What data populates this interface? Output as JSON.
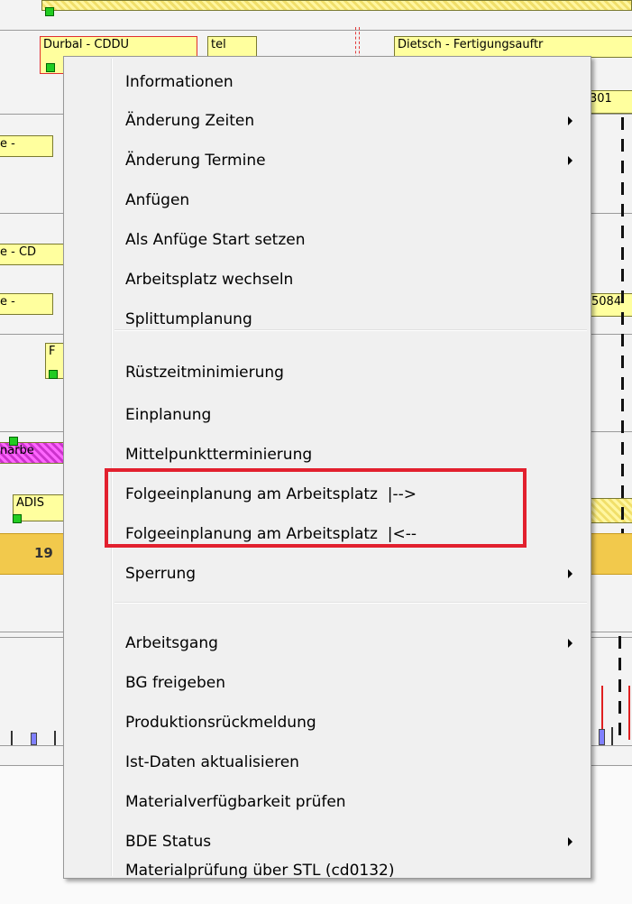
{
  "gantt": {
    "bar_top_label": "Durbal - CDDU",
    "bar_top_small": "tel",
    "bar_top_right": "Dietsch - Fertigungsauftr",
    "bar_right_1": "301",
    "bar_left_1": "e -",
    "bar_left_2": "e - CD",
    "bar_left_3": "e -",
    "bar_right_2": "5084",
    "bar_left_4": "F",
    "bar_left_5": "narbe",
    "bar_left_6": "ADIS",
    "date_label": "19"
  },
  "menu": {
    "items": [
      {
        "label": "Informationen",
        "submenu": false
      },
      {
        "label": "Änderung Zeiten",
        "submenu": true
      },
      {
        "label": "Änderung Termine",
        "submenu": true
      },
      {
        "label": "Anfügen",
        "submenu": false
      },
      {
        "label": "Als Anfüge Start setzen",
        "submenu": false
      },
      {
        "label": "Arbeitsplatz wechseln",
        "submenu": false
      },
      {
        "label": "Splittumplanung",
        "submenu": false
      },
      {
        "label": "Rüstzeitminimierung",
        "submenu": false
      },
      {
        "label": "Einplanung",
        "submenu": false
      },
      {
        "label": "Mittelpunktterminierung",
        "submenu": false
      },
      {
        "label": "Folgeeinplanung am Arbeitsplatz  |-->",
        "submenu": false
      },
      {
        "label": "Folgeeinplanung am Arbeitsplatz  |<--",
        "submenu": false
      },
      {
        "label": "Sperrung",
        "submenu": true
      },
      {
        "label": "Arbeitsgang",
        "submenu": true
      },
      {
        "label": "BG freigeben",
        "submenu": false
      },
      {
        "label": "Produktionsrückmeldung",
        "submenu": false
      },
      {
        "label": "Ist-Daten aktualisieren",
        "submenu": false
      },
      {
        "label": "Materialverfügbarkeit prüfen",
        "submenu": false
      },
      {
        "label": "BDE Status",
        "submenu": true
      },
      {
        "label": "Materialprüfung über STL (cd0132)",
        "submenu": false
      }
    ],
    "highlight_color": "#e2202e"
  }
}
